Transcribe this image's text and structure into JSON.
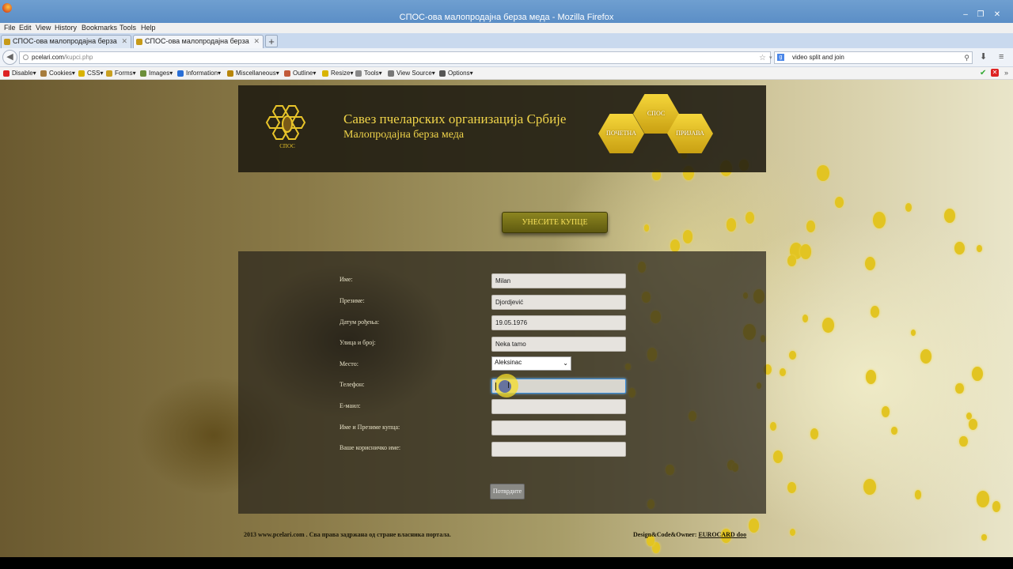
{
  "window": {
    "title": "СПОС-ова малопродајна берза меда - Mozilla Firefox",
    "controls": [
      "–",
      "❐",
      "✕"
    ]
  },
  "menubar": [
    "File",
    "Edit",
    "View",
    "History",
    "Bookmarks",
    "Tools",
    "Help"
  ],
  "tabs": [
    {
      "label": "СПОС-ова малопродајна берза меда",
      "close": "✕"
    },
    {
      "label": "СПОС-ова малопродајна берза меда",
      "close": "✕"
    }
  ],
  "newtab_label": "+",
  "navbar": {
    "back": "◀",
    "url_host": "pcelari.com",
    "url_path": "/kupci.php",
    "star": "☆",
    "dropdown": "▾",
    "reload": "C",
    "search_engine": "g",
    "search_value": "video split and join",
    "search_icon": "⚲",
    "download_icon": "⬇",
    "menu_icon": "≡"
  },
  "webdev_toolbar": [
    {
      "label": "Disable▾",
      "icon_color": "#d22"
    },
    {
      "label": "Cookies▾",
      "icon_color": "#a67c3d"
    },
    {
      "label": "CSS▾",
      "icon_color": "#d9b300"
    },
    {
      "label": "Forms▾",
      "icon_color": "#c9a020"
    },
    {
      "label": "Images▾",
      "icon_color": "#6b8e3a"
    },
    {
      "label": "Information▾",
      "icon_color": "#2a6fd6"
    },
    {
      "label": "Miscellaneous▾",
      "icon_color": "#b8860b"
    },
    {
      "label": "Outline▾",
      "icon_color": "#c25a3a"
    },
    {
      "label": "Resize▾",
      "icon_color": "#d8b400"
    },
    {
      "label": "Tools▾",
      "icon_color": "#888"
    },
    {
      "label": "View Source▾",
      "icon_color": "#777"
    },
    {
      "label": "Options▾",
      "icon_color": "#555"
    }
  ],
  "webdev_status": {
    "ok": "✔",
    "error": "✕",
    "more": "»"
  },
  "header": {
    "title": "Савез пчеларских организација Србије",
    "subtitle": "Малопродајна берза меда",
    "logo_text": "СПОС",
    "nav": {
      "spos": "СПОС",
      "home": "ПОЧЕТНА",
      "login": "ПРИЈАВА"
    }
  },
  "enter_buyers_button": "УНЕСИТЕ КУПЦЕ",
  "form": {
    "fields": [
      {
        "label": "Име:",
        "value": "Milan"
      },
      {
        "label": "Презиме:",
        "value": "Djordjević"
      },
      {
        "label": "Датум рођења:",
        "value": "19.05.1976"
      },
      {
        "label": "Улица и број:",
        "value": "Neka tamo"
      },
      {
        "label": "Место:",
        "value": "Aleksinac"
      },
      {
        "label": "Телефон:",
        "value": ""
      },
      {
        "label": "Е-маил:",
        "value": ""
      },
      {
        "label": "Име и Презиме купца:",
        "value": ""
      },
      {
        "label": "Ваше корисничко име:",
        "value": ""
      }
    ],
    "select_caret": "⌄",
    "submit_label": "Потврдите"
  },
  "footer": {
    "left": "2013 www.pcelari.com . Сва права задржана од стране власника портала.",
    "right_prefix": "Design&Code&Owner: ",
    "right_brand": "EUROCARD doo"
  },
  "colors": {
    "accent": "#f0d44a",
    "titlebar": "#5b8ec6",
    "focus": "#3c8dd8"
  }
}
